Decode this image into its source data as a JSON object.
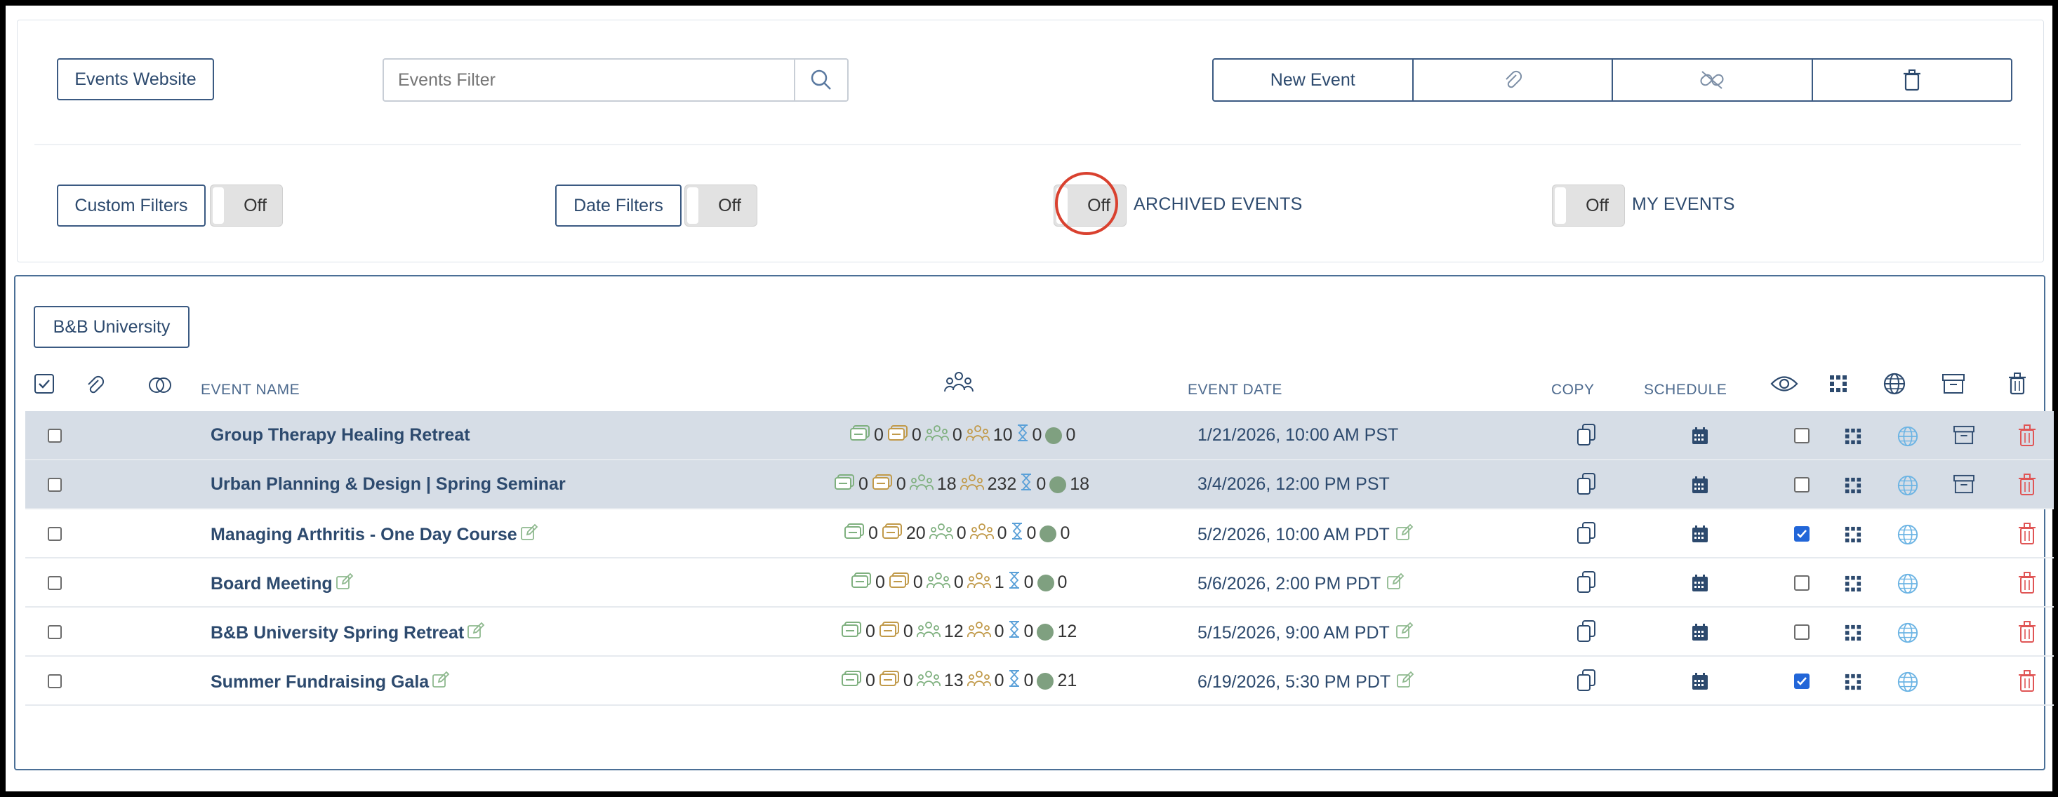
{
  "top": {
    "events_website": "Events Website",
    "filter_placeholder": "Events Filter",
    "toolbar": {
      "new_event": "New Event"
    }
  },
  "filters": {
    "custom_filters": "Custom Filters",
    "custom_state": "Off",
    "date_filters": "Date Filters",
    "date_state": "Off",
    "archived_state": "Off",
    "archived_label": "ARCHIVED EVENTS",
    "my_state": "Off",
    "my_label": "MY EVENTS"
  },
  "org": "B&B University",
  "headers": {
    "event_name": "EVENT NAME",
    "event_date": "EVENT DATE",
    "copy": "COPY",
    "schedule": "SCHEDULE"
  },
  "rows": [
    {
      "name": "Group Therapy Healing Retreat",
      "a": "0",
      "b": "0",
      "c": "0",
      "d": "10",
      "e": "0",
      "f": "0",
      "date": "1/21/2026, 10:00 AM PST",
      "archived": true,
      "visible": false
    },
    {
      "name": "Urban Planning & Design | Spring Seminar",
      "a": "0",
      "b": "0",
      "c": "18",
      "d": "232",
      "e": "0",
      "f": "18",
      "date": "3/4/2026, 12:00 PM PST",
      "archived": true,
      "visible": false
    },
    {
      "name": "Managing Arthritis - One Day Course",
      "a": "0",
      "b": "20",
      "c": "0",
      "d": "0",
      "e": "0",
      "f": "0",
      "date": "5/2/2026, 10:00 AM PDT",
      "archived": false,
      "visible": true
    },
    {
      "name": "Board Meeting",
      "a": "0",
      "b": "0",
      "c": "0",
      "d": "1",
      "e": "0",
      "f": "0",
      "date": "5/6/2026, 2:00 PM PDT",
      "archived": false,
      "visible": false
    },
    {
      "name": "B&B University Spring Retreat",
      "a": "0",
      "b": "0",
      "c": "12",
      "d": "0",
      "e": "0",
      "f": "12",
      "date": "5/15/2026, 9:00 AM PDT",
      "archived": false,
      "visible": false
    },
    {
      "name": "Summer Fundraising Gala",
      "a": "0",
      "b": "0",
      "c": "13",
      "d": "0",
      "e": "0",
      "f": "21",
      "date": "6/19/2026, 5:30 PM PDT",
      "archived": false,
      "visible": true
    }
  ],
  "colors": {
    "navy": "#2d4a6e",
    "archived_row": "#d6dde6",
    "delete": "#e05555",
    "highlight": "#d9412f",
    "checked": "#2266d8"
  }
}
